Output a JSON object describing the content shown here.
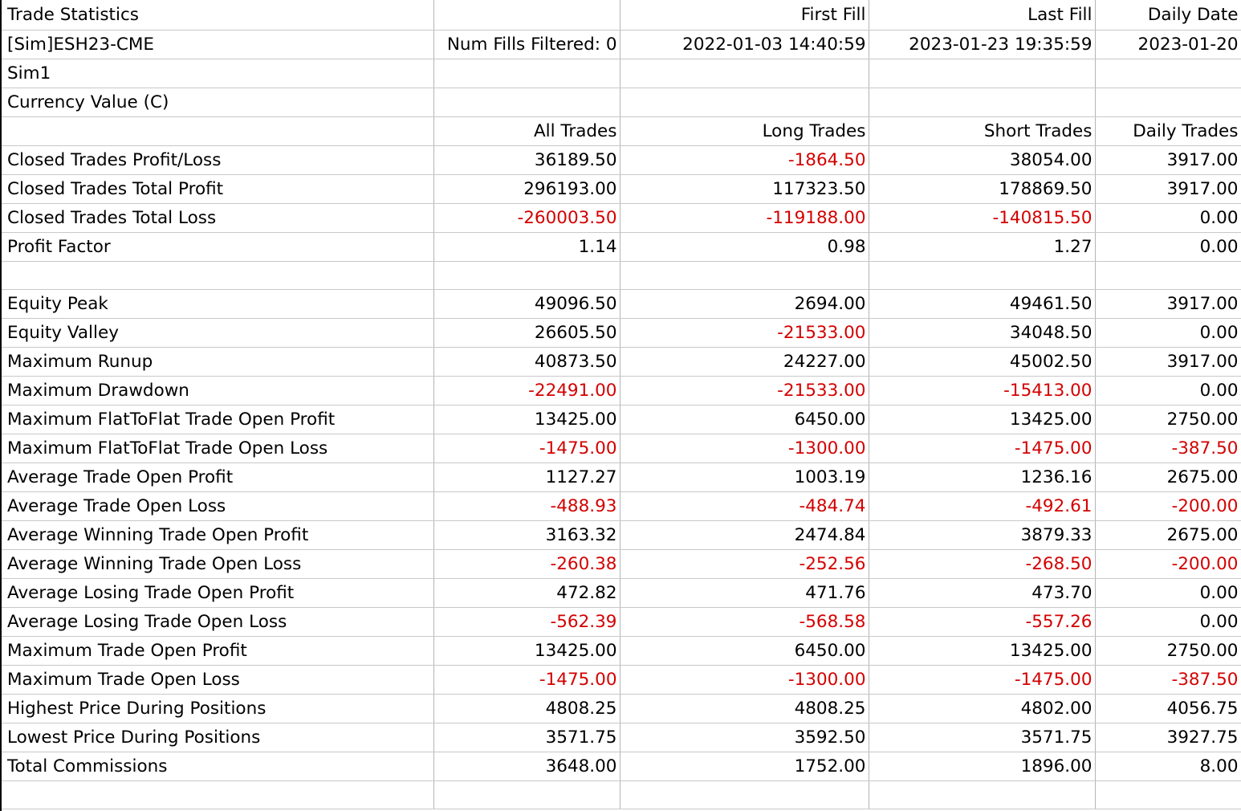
{
  "neg_color": "#d40000",
  "text_color": "#000000",
  "header": {
    "title": "Trade Statistics",
    "first_fill_label": "First Fill",
    "last_fill_label": "Last Fill",
    "daily_date_label": "Daily Date",
    "symbol": "[Sim]ESH23-CME",
    "num_fills_filtered": "Num Fills Filtered: 0",
    "first_fill_value": "2022-01-03  14:40:59",
    "last_fill_value": "2023-01-23  19:35:59",
    "daily_date_value": "2023-01-20",
    "account": "Sim1",
    "value_mode": "Currency Value (C)"
  },
  "columns": [
    "All Trades",
    "Long Trades",
    "Short Trades",
    "Daily Trades"
  ],
  "section1": [
    {
      "label": "Closed Trades Profit/Loss",
      "values": [
        "36189.50",
        "-1864.50",
        "38054.00",
        "3917.00"
      ]
    },
    {
      "label": "Closed Trades Total Profit",
      "values": [
        "296193.00",
        "117323.50",
        "178869.50",
        "3917.00"
      ]
    },
    {
      "label": "Closed Trades Total Loss",
      "values": [
        "-260003.50",
        "-119188.00",
        "-140815.50",
        "0.00"
      ]
    },
    {
      "label": "Profit Factor",
      "values": [
        "1.14",
        "0.98",
        "1.27",
        "0.00"
      ]
    }
  ],
  "section2": [
    {
      "label": "Equity Peak",
      "values": [
        "49096.50",
        "2694.00",
        "49461.50",
        "3917.00"
      ]
    },
    {
      "label": "Equity Valley",
      "values": [
        "26605.50",
        "-21533.00",
        "34048.50",
        "0.00"
      ]
    },
    {
      "label": "Maximum Runup",
      "values": [
        "40873.50",
        "24227.00",
        "45002.50",
        "3917.00"
      ]
    },
    {
      "label": "Maximum Drawdown",
      "values": [
        "-22491.00",
        "-21533.00",
        "-15413.00",
        "0.00"
      ]
    },
    {
      "label": "Maximum FlatToFlat Trade Open Profit",
      "values": [
        "13425.00",
        "6450.00",
        "13425.00",
        "2750.00"
      ]
    },
    {
      "label": "Maximum FlatToFlat Trade Open Loss",
      "values": [
        "-1475.00",
        "-1300.00",
        "-1475.00",
        "-387.50"
      ]
    },
    {
      "label": "Average Trade Open Profit",
      "values": [
        "1127.27",
        "1003.19",
        "1236.16",
        "2675.00"
      ]
    },
    {
      "label": "Average Trade Open Loss",
      "values": [
        "-488.93",
        "-484.74",
        "-492.61",
        "-200.00"
      ]
    },
    {
      "label": "Average Winning Trade Open Profit",
      "values": [
        "3163.32",
        "2474.84",
        "3879.33",
        "2675.00"
      ]
    },
    {
      "label": "Average Winning Trade Open Loss",
      "values": [
        "-260.38",
        "-252.56",
        "-268.50",
        "-200.00"
      ]
    },
    {
      "label": "Average Losing Trade Open Profit",
      "values": [
        "472.82",
        "471.76",
        "473.70",
        "0.00"
      ]
    },
    {
      "label": "Average Losing Trade Open Loss",
      "values": [
        "-562.39",
        "-568.58",
        "-557.26",
        "0.00"
      ]
    },
    {
      "label": "Maximum Trade Open Profit",
      "values": [
        "13425.00",
        "6450.00",
        "13425.00",
        "2750.00"
      ]
    },
    {
      "label": "Maximum Trade Open Loss",
      "values": [
        "-1475.00",
        "-1300.00",
        "-1475.00",
        "-387.50"
      ]
    },
    {
      "label": "Highest Price During Positions",
      "values": [
        "4808.25",
        "4808.25",
        "4802.00",
        "4056.75"
      ]
    },
    {
      "label": "Lowest Price During Positions",
      "values": [
        "3571.75",
        "3592.50",
        "3571.75",
        "3927.75"
      ]
    },
    {
      "label": "Total Commissions",
      "values": [
        "3648.00",
        "1752.00",
        "1896.00",
        "8.00"
      ]
    }
  ]
}
